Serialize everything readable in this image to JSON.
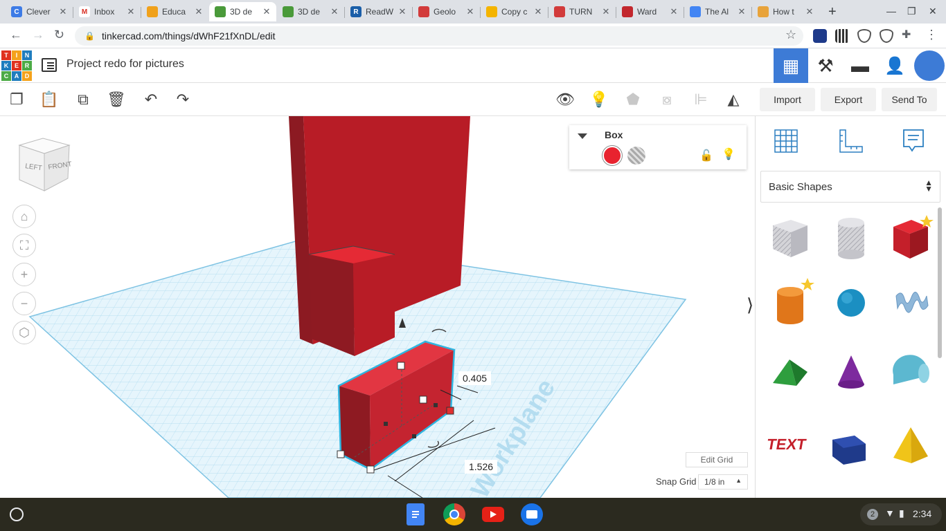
{
  "browser": {
    "tabs": [
      {
        "title": "Clever",
        "favicon_color": "#3d7be6",
        "favicon_letter": "C"
      },
      {
        "title": "Inbox",
        "favicon_color": "#ffffff",
        "favicon_letter": "M"
      },
      {
        "title": "Educa",
        "favicon_color": "#f0a11b",
        "favicon_letter": ""
      },
      {
        "title": "3D de",
        "favicon_color": "#4a9a3a",
        "favicon_letter": ""
      },
      {
        "title": "3D de",
        "favicon_color": "#4a9a3a",
        "favicon_letter": ""
      },
      {
        "title": "ReadW",
        "favicon_color": "#1a5ea8",
        "favicon_letter": "R"
      },
      {
        "title": "Geolo",
        "favicon_color": "#d23b3b",
        "favicon_letter": ""
      },
      {
        "title": "Copy c",
        "favicon_color": "#f4b400",
        "favicon_letter": ""
      },
      {
        "title": "TURN",
        "favicon_color": "#d23b3b",
        "favicon_letter": ""
      },
      {
        "title": "Ward",
        "favicon_color": "#c2272d",
        "favicon_letter": ""
      },
      {
        "title": "The Al",
        "favicon_color": "#4285f4",
        "favicon_letter": ""
      },
      {
        "title": "How t",
        "favicon_color": "#e8a33b",
        "favicon_letter": ""
      }
    ],
    "active_tab_index": 3,
    "url": "tinkercad.com/things/dWhF21fXnDL/edit"
  },
  "app": {
    "logo_letters": [
      "T",
      "I",
      "N",
      "K",
      "E",
      "R",
      "C",
      "A",
      "D"
    ],
    "project_title": "Project redo for pictures"
  },
  "toolbar": {
    "import_label": "Import",
    "export_label": "Export",
    "sendto_label": "Send To"
  },
  "viewcube": {
    "left_label": "LEFT",
    "front_label": "FRONT"
  },
  "inspector": {
    "shape_name": "Box",
    "solid_color": "#e8232f"
  },
  "dimensions": {
    "depth_value": "0.405",
    "length_value": "1.526"
  },
  "workplane": {
    "watermark": "Workplane",
    "edit_grid_label": "Edit Grid",
    "snap_grid_label": "Snap Grid",
    "snap_grid_value": "1/8 in"
  },
  "panel": {
    "category": "Basic Shapes",
    "shapes": [
      {
        "name": "Box Hole",
        "starred": false
      },
      {
        "name": "Cylinder Hole",
        "starred": false
      },
      {
        "name": "Box",
        "starred": true
      },
      {
        "name": "Cylinder",
        "starred": true
      },
      {
        "name": "Sphere",
        "starred": false
      },
      {
        "name": "Scribble",
        "starred": false
      },
      {
        "name": "Roof",
        "starred": false
      },
      {
        "name": "Cone",
        "starred": false
      },
      {
        "name": "Round Roof",
        "starred": false
      },
      {
        "name": "Text",
        "starred": false
      },
      {
        "name": "Polygon",
        "starred": false
      },
      {
        "name": "Pyramid",
        "starred": false
      }
    ]
  },
  "shelf": {
    "notification_count": "2",
    "time": "2:34"
  },
  "colors": {
    "accent_blue": "#3d7bd6",
    "box_red": "#e8232f",
    "selection_cyan": "#2fb5e0"
  }
}
